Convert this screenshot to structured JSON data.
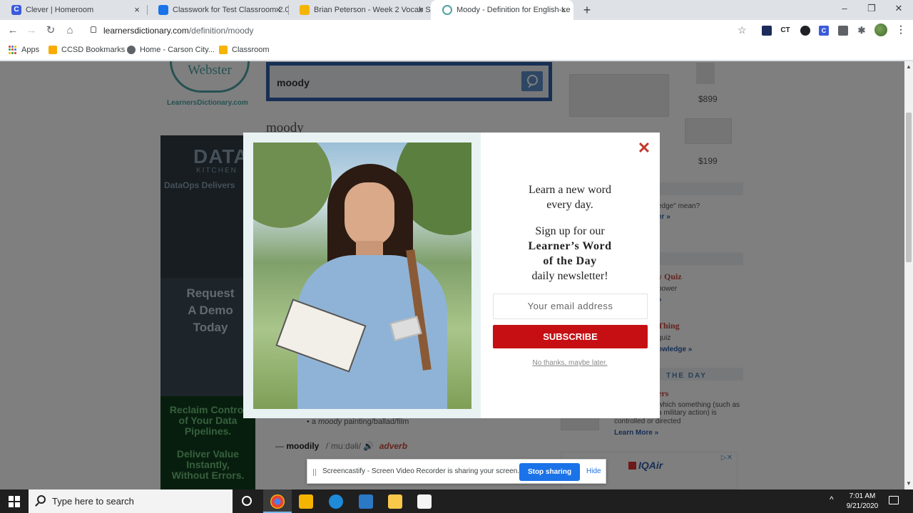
{
  "browser": {
    "tabs": [
      {
        "title": "Clever | Homeroom",
        "favicon_color": "#3b5bdb",
        "letter": "C"
      },
      {
        "title": "Classwork for Test Classroom 2.0",
        "favicon_color": "#1a73e8",
        "letter": ""
      },
      {
        "title": "Brian Peterson - Week 2 Vocab Sl",
        "favicon_color": "#f4b400",
        "letter": ""
      },
      {
        "title": "Moody - Definition for English-Le",
        "favicon_color": "#4fa3a5",
        "letter": "",
        "active": true
      }
    ],
    "close_glyph": "×",
    "new_tab_glyph": "+",
    "window_controls": [
      "–",
      "❐",
      "✕"
    ],
    "url_host": "learnersdictionary.com",
    "url_path": "/definition/moody",
    "extensions": [
      {
        "label": "",
        "color": "#1c2b5a"
      },
      {
        "label": "CT",
        "color": "#ffffff"
      },
      {
        "label": "",
        "color": "#202124"
      },
      {
        "label": "C",
        "color": "#3b5bdb"
      },
      {
        "label": "",
        "color": "#5f6368"
      },
      {
        "label": "",
        "color": "#5f6368"
      }
    ],
    "bookmarks": [
      {
        "label": "Apps",
        "icon": "apps-grid-icon"
      },
      {
        "label": "CCSD Bookmarks",
        "icon": "folder-icon",
        "color": "#f9ab00"
      },
      {
        "label": "Home - Carson City...",
        "icon": "globe-icon",
        "color": "#5f6368"
      },
      {
        "label": "Classroom",
        "icon": "classroom-icon",
        "color": "#f4b400"
      }
    ]
  },
  "page": {
    "logo_text": "Webster",
    "logo_caption": "LearnersDictionary.com",
    "search_value": "moody",
    "headword": "moody",
    "ad_left": {
      "brand": "DATA",
      "brand_sub": "KITCHEN",
      "tagline": "DataOps Delivers",
      "cta": "Request\nA Demo\nToday",
      "reclaim": "Reclaim Control\nof Your Data\nPipelines.",
      "deliver": "Deliver Value\nInstantly,\nWithout Errors."
    },
    "example_prefix": "a ",
    "example_word": "moody",
    "example_suffix": " painting/ballad/film",
    "runon_dash": "—",
    "runon_word": "moodily",
    "runon_pron": "/ˈmuːdəli/",
    "runon_pos": "adverb",
    "right_col": {
      "price1": "$899",
      "price2": "$199",
      "q_text": "edge\" mean?",
      "q_link": "er »",
      "quiz_title": "y Quiz",
      "quiz_text": "power",
      "quiz_link": "»",
      "thing_title": "Thing",
      "thing_text": "quiz",
      "thing_link": "owledge »",
      "wotd_label": "THE DAY",
      "wotd_word": "ers",
      "wotd_def1": "which something (such as",
      "wotd_def2": "a military action) is",
      "wotd_def3": "controlled or directed",
      "learn_more": "Learn More »",
      "ad_brand": "IQAir"
    }
  },
  "modal": {
    "line1": "Learn a new word",
    "line2": "every day.",
    "line3": "Sign up for our",
    "line4": "Learner’s Word",
    "line5": "of the Day",
    "line6": "daily newsletter!",
    "email_placeholder": "Your email address",
    "subscribe_label": "SUBSCRIBE",
    "no_thanks": "No thanks, maybe later.",
    "close_glyph": "✕"
  },
  "sharebar": {
    "text": "Screencastify - Screen Video Recorder is sharing your screen.",
    "stop_label": "Stop sharing",
    "hide_label": "Hide"
  },
  "taskbar": {
    "search_placeholder": "Type here to search",
    "time": "7:01 AM",
    "date": "9/21/2020",
    "tray_caret": "^",
    "pinned": [
      {
        "name": "chrome-icon",
        "color": "#e8453c"
      },
      {
        "name": "slides-app-icon",
        "color": "#f4b400"
      },
      {
        "name": "edge-icon",
        "color": "#1f8ad8"
      },
      {
        "name": "mail-icon",
        "color": "#2b78c5"
      },
      {
        "name": "file-explorer-icon",
        "color": "#f8c84a"
      },
      {
        "name": "store-icon",
        "color": "#f4f4f4"
      }
    ]
  }
}
